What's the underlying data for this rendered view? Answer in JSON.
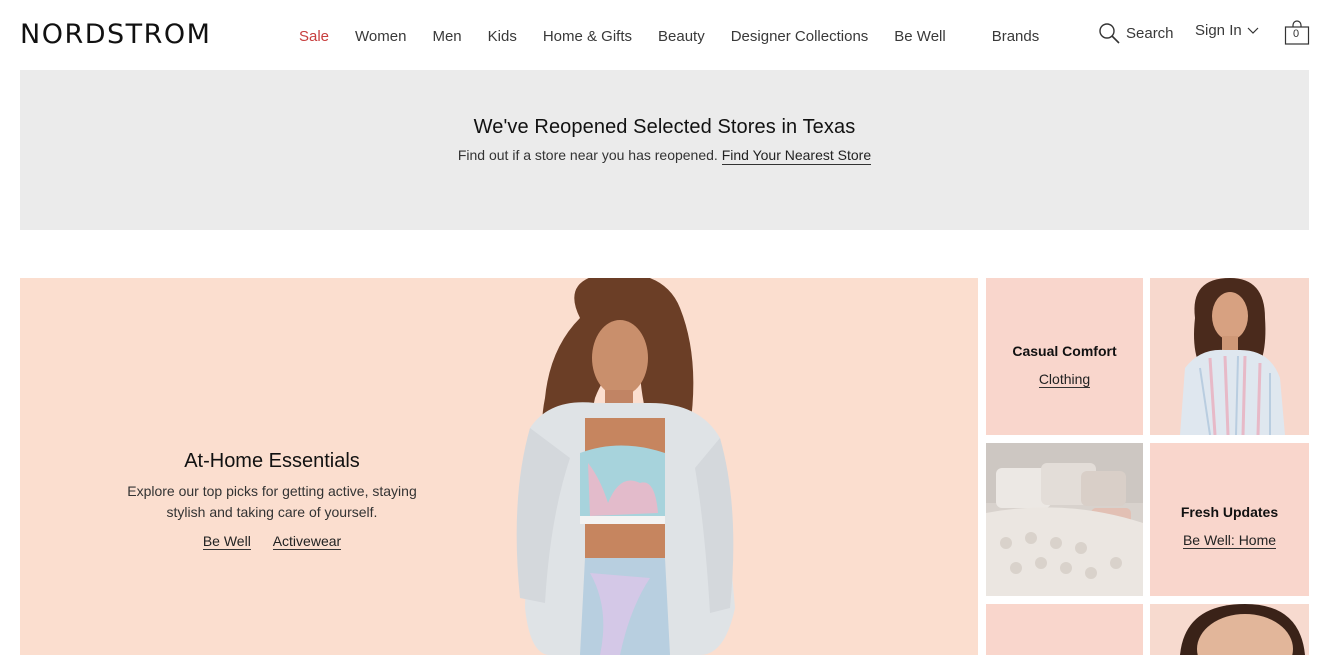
{
  "header": {
    "logo": "NORDSTROM",
    "nav": [
      "Sale",
      "Women",
      "Men",
      "Kids",
      "Home & Gifts",
      "Beauty",
      "Designer Collections",
      "Be Well",
      "Brands"
    ],
    "search_label": "Search",
    "signin_label": "Sign In",
    "bag_count": "0"
  },
  "banner": {
    "title": "We've Reopened Selected Stores in Texas",
    "text": "Find out if a store near you has reopened.",
    "link": "Find Your Nearest Store"
  },
  "hero": {
    "title": "At-Home Essentials",
    "description_line1": "Explore our top picks for getting active, staying",
    "description_line2": "stylish and taking care of yourself.",
    "links": [
      "Be Well",
      "Activewear"
    ]
  },
  "tiles": {
    "casual": {
      "title": "Casual Comfort",
      "link": "Clothing"
    },
    "fresh": {
      "title": "Fresh Updates",
      "link": "Be Well: Home"
    }
  },
  "colors": {
    "sale": "#c73d3d",
    "banner_bg": "#ebebeb",
    "hero_bg": "#fbdecf",
    "tile_pink": "#f9d6cc"
  }
}
